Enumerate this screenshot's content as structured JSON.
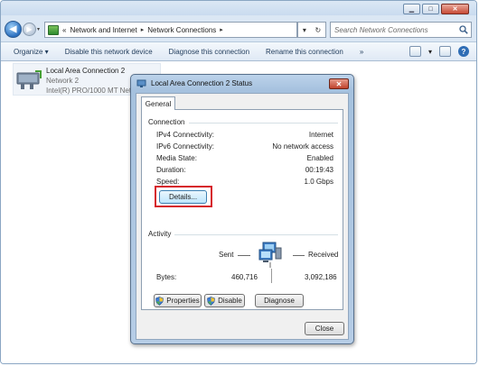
{
  "window": {
    "controls": {
      "minimize": "▁",
      "maximize": "□",
      "close": "✕"
    }
  },
  "address": {
    "prefix": "«",
    "crumbs": [
      "Network and Internet",
      "Network Connections"
    ],
    "separator": "▸",
    "refresh": "↻",
    "history_drop": "▾"
  },
  "search": {
    "placeholder": "Search Network Connections",
    "icon": "search-icon"
  },
  "toolbar": {
    "items": [
      "Organize ▾",
      "Disable this network device",
      "Diagnose this connection",
      "Rename this connection",
      "»"
    ],
    "view_drop": "▾",
    "help": "?"
  },
  "connection_item": {
    "name": "Local Area Connection 2",
    "network": "Network  2",
    "adapter": "Intel(R) PRO/1000 MT Netw"
  },
  "dialog": {
    "title": "Local Area Connection 2 Status",
    "close": "✕",
    "tab": "General",
    "connection": {
      "label": "Connection",
      "rows": [
        {
          "key": "IPv4 Connectivity:",
          "value": "Internet"
        },
        {
          "key": "IPv6 Connectivity:",
          "value": "No network access"
        },
        {
          "key": "Media State:",
          "value": "Enabled"
        },
        {
          "key": "Duration:",
          "value": "00:19:43"
        },
        {
          "key": "Speed:",
          "value": "1.0 Gbps"
        }
      ],
      "details_button": "Details..."
    },
    "activity": {
      "label": "Activity",
      "sent_label": "Sent",
      "received_label": "Received",
      "bytes_label": "Bytes:",
      "bytes_sent": "460,716",
      "bytes_received": "3,092,186"
    },
    "buttons": {
      "properties": "Properties",
      "disable": "Disable",
      "diagnose": "Diagnose",
      "close": "Close"
    }
  },
  "colors": {
    "highlight": "#d6202b",
    "window_frame": "#dbe7f4",
    "toolbar_text": "#1e3a5a"
  }
}
